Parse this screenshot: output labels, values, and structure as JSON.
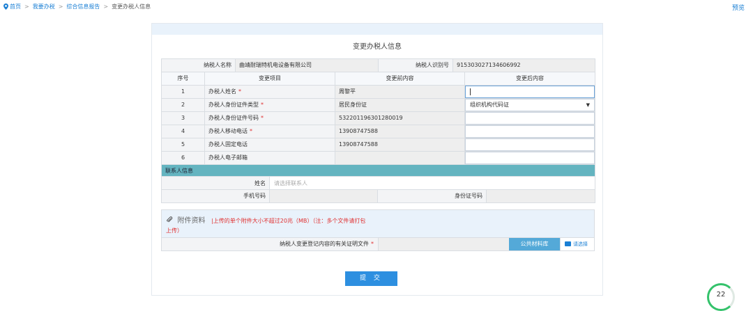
{
  "breadcrumb": {
    "items": [
      "首页",
      "我要办税",
      "综合信息报告",
      "变更办税人信息"
    ],
    "separator": ">"
  },
  "preview_label": "预览",
  "form": {
    "title": "变更办税人信息",
    "taxpayer_name_label": "纳税人名称",
    "taxpayer_name": "曲靖耐瑞特机电设备有限公司",
    "taxpayer_id_label": "纳税人识别号",
    "taxpayer_id": "915303027134606992",
    "columns": {
      "seq": "序号",
      "item": "变更项目",
      "before": "变更前内容",
      "after": "变更后内容"
    },
    "rows": [
      {
        "seq": "1",
        "item": "办税人姓名",
        "required": "*",
        "before": "周黎平",
        "after": ""
      },
      {
        "seq": "2",
        "item": "办税人身份证件类型",
        "required": "*",
        "before": "居民身份证",
        "after": "组织机构代码证"
      },
      {
        "seq": "3",
        "item": "办税人身份证件号码",
        "required": "*",
        "before": "532201196301280019",
        "after": ""
      },
      {
        "seq": "4",
        "item": "办税人移动电话",
        "required": "*",
        "before": "13908747588",
        "after": ""
      },
      {
        "seq": "5",
        "item": "办税人固定电话",
        "required": "",
        "before": "13908747588",
        "after": ""
      },
      {
        "seq": "6",
        "item": "办税人电子邮箱",
        "required": "",
        "before": "",
        "after": ""
      }
    ]
  },
  "contact": {
    "section_title": "联系人信息",
    "name_label": "姓名",
    "name_placeholder": "请选择联系人",
    "phone_label": "手机号码",
    "id_label": "身份证号码"
  },
  "attachment": {
    "title": "附件资料",
    "note_line1": "|上传的单个附件大小不超过20兆（MB）（注：多个文件请打包",
    "note_line2": "上传）",
    "file_label": "纳税人变更登记内容的有关证明文件",
    "required": "*",
    "public_library": "公共材料库",
    "choose": "请选择"
  },
  "submit_label": "提 交",
  "badge_value": "22",
  "colors": {
    "link": "#1a7fd4",
    "section_bar": "#64b4c0",
    "submit": "#2d8fe0",
    "required": "#e03030"
  }
}
